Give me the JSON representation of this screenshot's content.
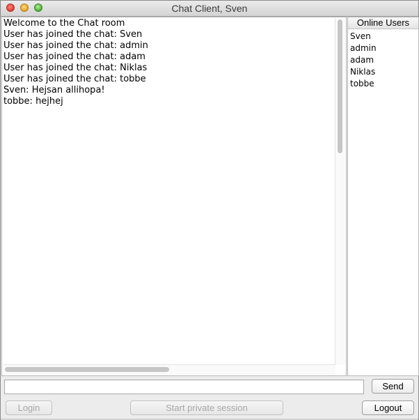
{
  "window": {
    "title": "Chat Client, Sven"
  },
  "chat": {
    "lines": [
      "Welcome to the Chat room",
      "User has joined the chat: Sven",
      "User has joined the chat: admin",
      "User has joined the chat: adam",
      "User has joined the chat: Niklas",
      "User has joined the chat: tobbe",
      "Sven: Hejsan allihopa!",
      "tobbe: hejhej"
    ]
  },
  "users": {
    "header": "Online Users",
    "items": [
      "Sven",
      "admin",
      "adam",
      "Niklas",
      "tobbe"
    ]
  },
  "input": {
    "value": "",
    "placeholder": ""
  },
  "buttons": {
    "send": "Send",
    "login": "Login",
    "private_session": "Start private session",
    "logout": "Logout"
  },
  "colors": {
    "close": "#e0443a",
    "minimize": "#e8a72c",
    "maximize": "#58b33c"
  }
}
